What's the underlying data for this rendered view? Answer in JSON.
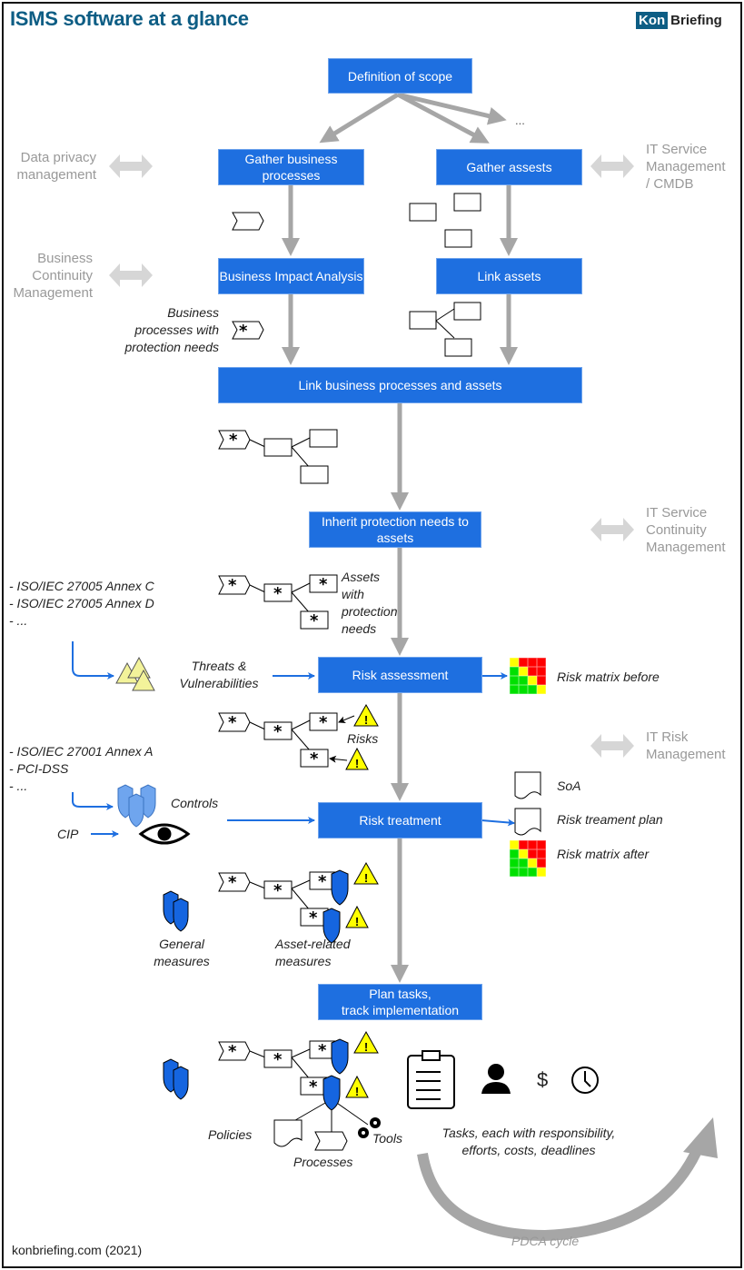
{
  "header": {
    "title": "ISMS software at a glance",
    "logo_part1": "Kon",
    "logo_part2": "Briefing"
  },
  "colors": {
    "box_blue": "#1e6fe0",
    "title_teal": "#0d5d84",
    "gray_arrow": "#a6a6a6",
    "side_gray": "#999999",
    "shield_blue": "#1565e0",
    "warning_yellow": "#ffff00",
    "matrix_red": "#ff0000",
    "matrix_yellow": "#ffff00",
    "matrix_green": "#00e000"
  },
  "process_steps": {
    "scope": "Definition of scope",
    "more": "...",
    "gather_processes": "Gather business processes",
    "gather_assets": "Gather assests",
    "bia": "Business Impact Analysis",
    "link_assets": "Link assets",
    "link_processes_assets": "Link business processes and assets",
    "inherit": "Inherit protection needs to assets",
    "risk_assessment": "Risk assessment",
    "risk_treatment": "Risk treatment",
    "plan_tasks_line1": "Plan tasks,",
    "plan_tasks_line2": "track implementation"
  },
  "related_disciplines": {
    "data_privacy": [
      "Data privacy",
      "management"
    ],
    "itsm": [
      "IT Service",
      "Management",
      "/ CMDB"
    ],
    "bcm": [
      "Business",
      "Continuity",
      "Management"
    ],
    "itscm": [
      "IT Service",
      "Continuity",
      "Management"
    ],
    "it_risk": [
      "IT Risk",
      "Management"
    ]
  },
  "annotations": {
    "bp_protection": [
      "Business",
      "processes with",
      "protection needs"
    ],
    "assets_protection": [
      "Assets",
      "with",
      "protection",
      "needs"
    ],
    "threat_sources": [
      "- ISO/IEC 27005 Annex C",
      "- ISO/IEC 27005 Annex D",
      "- ..."
    ],
    "threats_label": [
      "Threats &",
      "Vulnerabilities"
    ],
    "risk_matrix_before": "Risk matrix before",
    "risks_label": "Risks",
    "control_sources": [
      "- ISO/IEC 27001 Annex A",
      "- PCI-DSS",
      "- ..."
    ],
    "controls_label": "Controls",
    "cip_label": "CIP",
    "soa": "SoA",
    "risk_treatment_plan": "Risk treament plan",
    "risk_matrix_after": "Risk matrix after",
    "general_measures": [
      "General",
      "measures"
    ],
    "asset_measures": [
      "Asset-related",
      "measures"
    ],
    "policies": "Policies",
    "processes": "Processes",
    "tools": "Tools",
    "tasks": [
      "Tasks, each with responsibility,",
      "efforts, costs, deadlines"
    ],
    "dollar": "$",
    "pdca": "PDCA cycle",
    "asterisk": "*"
  },
  "risk_matrix_before": [
    [
      "Y",
      "R",
      "R",
      "R"
    ],
    [
      "G",
      "Y",
      "R",
      "R"
    ],
    [
      "G",
      "G",
      "Y",
      "R"
    ],
    [
      "G",
      "G",
      "G",
      "Y"
    ]
  ],
  "risk_matrix_after": [
    [
      "Y",
      "R",
      "R",
      "R"
    ],
    [
      "G",
      "Y",
      "R",
      "R"
    ],
    [
      "G",
      "G",
      "Y",
      "R"
    ],
    [
      "G",
      "G",
      "G",
      "Y"
    ]
  ],
  "footer": {
    "credit": "konbriefing.com (2021)"
  }
}
